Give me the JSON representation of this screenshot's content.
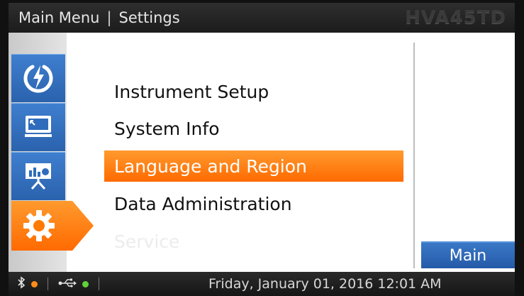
{
  "header": {
    "breadcrumb_root": "Main Menu",
    "separator": "|",
    "page_title": "Settings",
    "model": "HVA45TD"
  },
  "sidebar": {
    "items": [
      {
        "icon": "power-bolt-icon",
        "active": false
      },
      {
        "icon": "monitor-icon",
        "active": false
      },
      {
        "icon": "presentation-chart-icon",
        "active": false
      },
      {
        "icon": "gear-icon",
        "active": true
      }
    ]
  },
  "menu": {
    "items": [
      {
        "label": "Instrument Setup",
        "state": "normal"
      },
      {
        "label": "System Info",
        "state": "normal"
      },
      {
        "label": "Language and Region",
        "state": "selected"
      },
      {
        "label": "Data Administration",
        "state": "normal"
      },
      {
        "label": "Service",
        "state": "disabled"
      }
    ]
  },
  "main_button": {
    "label": "Main"
  },
  "status": {
    "bluetooth_icon": "bluetooth-icon",
    "bluetooth_dot_color": "#ff8c1a",
    "usb_icon": "usb-icon",
    "usb_dot_color": "#5fd13a",
    "datetime": "Friday, January 01, 2016 12:01 AM"
  },
  "colors": {
    "accent_orange": "#ff7a00",
    "nav_blue": "#2f6cbc",
    "header_bg": "#222222"
  }
}
